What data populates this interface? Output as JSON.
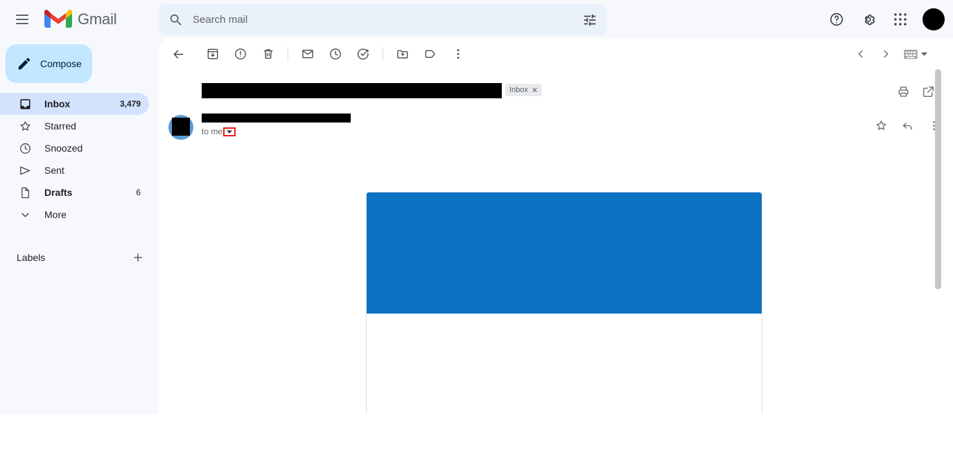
{
  "header": {
    "menu_icon": "hamburger-menu-icon",
    "brand": "Gmail",
    "search": {
      "placeholder": "Search mail",
      "value": "",
      "search_icon": "search-icon",
      "options_icon": "tune-options-icon"
    },
    "right_icons": [
      {
        "name": "help-icon",
        "label": "Support"
      },
      {
        "name": "gear-icon",
        "label": "Settings"
      },
      {
        "name": "apps-grid-icon",
        "label": "Google apps"
      }
    ],
    "avatar": {
      "name": "account-avatar",
      "redacted": true
    }
  },
  "sidebar": {
    "compose": {
      "label": "Compose",
      "icon": "pencil-icon"
    },
    "items": [
      {
        "label": "Inbox",
        "icon": "inbox-icon",
        "count": "3,479",
        "active": true
      },
      {
        "label": "Starred",
        "icon": "star-icon",
        "count": "",
        "active": false
      },
      {
        "label": "Snoozed",
        "icon": "clock-icon",
        "count": "",
        "active": false
      },
      {
        "label": "Sent",
        "icon": "send-icon",
        "count": "",
        "active": false
      },
      {
        "label": "Drafts",
        "icon": "draft-file-icon",
        "count": "6",
        "active": false
      },
      {
        "label": "More",
        "icon": "chevron-down-icon",
        "count": "",
        "active": false
      }
    ],
    "labels": {
      "title": "Labels",
      "add_icon": "plus-icon"
    }
  },
  "toolbar": {
    "buttons": [
      {
        "name": "back-to-inbox-button",
        "icon": "arrow-left-icon"
      },
      {
        "name": "archive-button",
        "icon": "archive-icon"
      },
      {
        "name": "report-spam-button",
        "icon": "report-spam-icon"
      },
      {
        "name": "delete-button",
        "icon": "trash-icon"
      },
      {
        "name": "mark-unread-button",
        "icon": "envelope-icon"
      },
      {
        "name": "snooze-button",
        "icon": "clock-icon"
      },
      {
        "name": "add-to-tasks-button",
        "icon": "task-check-icon"
      },
      {
        "name": "move-to-button",
        "icon": "folder-move-icon"
      },
      {
        "name": "labels-button",
        "icon": "label-tag-icon"
      },
      {
        "name": "more-options-button",
        "icon": "more-vertical-icon"
      }
    ],
    "pagination": {
      "prev_icon": "chevron-left-icon",
      "next_icon": "chevron-right-icon",
      "input_tools_icon": "keyboard-icon",
      "input_tools_dropdown_icon": "caret-down-icon"
    }
  },
  "email": {
    "subject": {
      "redacted": true,
      "text": ""
    },
    "label_chip": {
      "label": "Inbox",
      "remove_icon": "close-x-icon"
    },
    "subject_actions": [
      {
        "name": "print-button",
        "icon": "printer-icon"
      },
      {
        "name": "open-in-new-window-button",
        "icon": "external-link-icon"
      }
    ],
    "sender": {
      "redacted": true,
      "text": ""
    },
    "avatar": {
      "name": "sender-avatar",
      "redacted": true,
      "color": "#5b9bd5"
    },
    "recipient_text": "to me",
    "details_toggle": {
      "name": "show-details-dropdown",
      "icon": "caret-down-icon",
      "highlighted": true,
      "highlight_color": "#ea1b1b"
    },
    "message_actions": [
      {
        "name": "star-message-button",
        "icon": "star-icon"
      },
      {
        "name": "reply-button",
        "icon": "reply-arrow-icon"
      },
      {
        "name": "message-more-button",
        "icon": "more-vertical-icon"
      }
    ],
    "body": {
      "banner_color": "#0b71c3",
      "card_background": "#ffffff",
      "card_border_color": "#e0e0e0"
    }
  },
  "scrollbar": {
    "name": "main-scrollbar",
    "thumb_color": "#c4c7c5"
  }
}
